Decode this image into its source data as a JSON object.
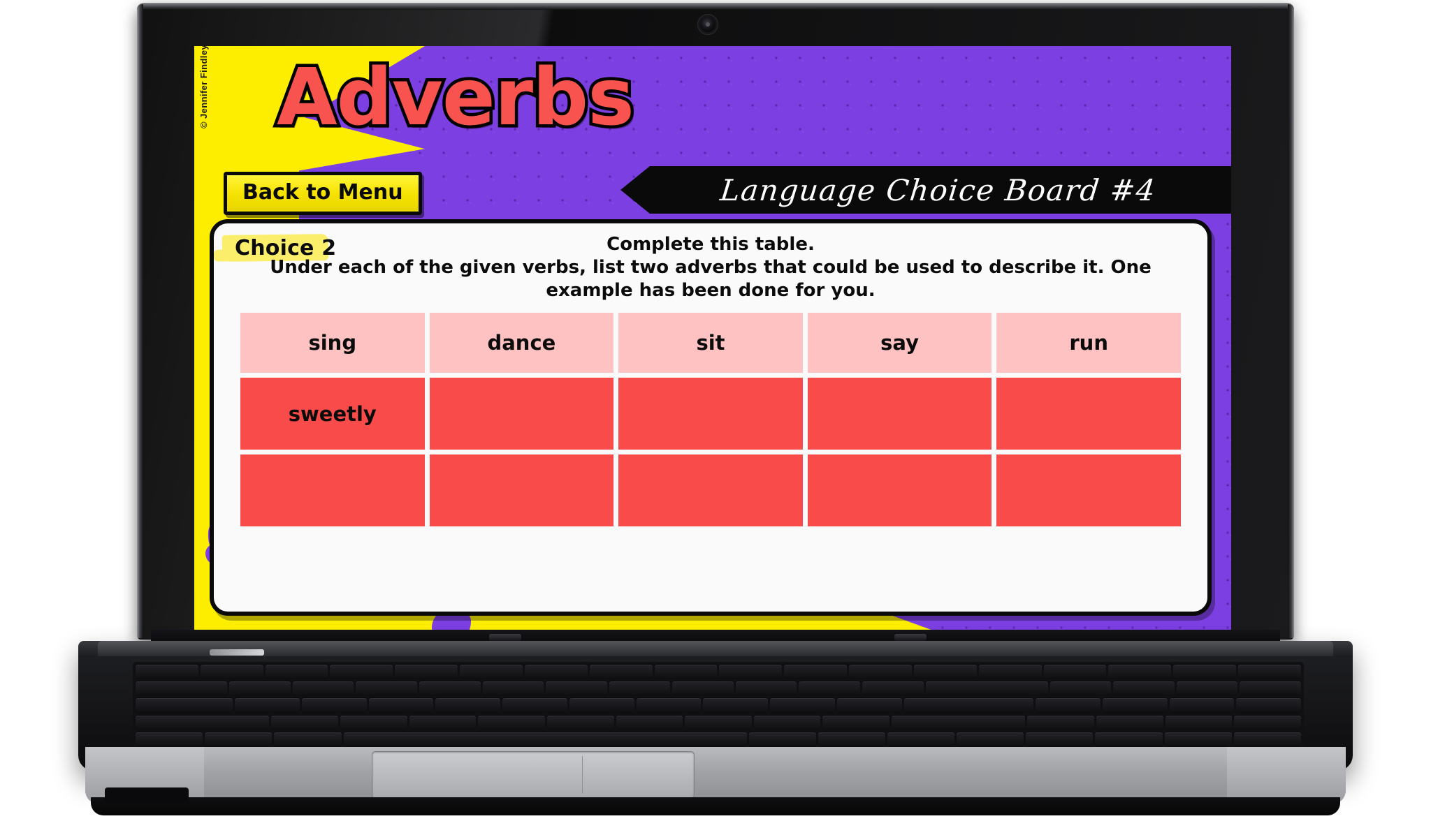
{
  "slide": {
    "title": "Adverbs",
    "copyright": "© Jennifer Findley",
    "back_button_label": "Back to Menu",
    "banner_text": "Language Choice Board #4",
    "colors": {
      "purple_background": "#7b3fe2",
      "yellow_accent": "#fdee00",
      "title_red": "#f8534e",
      "banner_black": "#0a0a0a",
      "card_white": "#fafafa",
      "header_cell_pink": "#ffc2c2",
      "body_cell_red": "#fa4b4b",
      "highlighter_yellow": "#fbee6a"
    }
  },
  "card": {
    "choice_label": "Choice 2",
    "instruction_line1": "Complete this table.",
    "instruction_line2": "Under each of the given verbs, list two adverbs that could be used to describe it. One example has been done for you."
  },
  "table": {
    "headers": [
      "sing",
      "dance",
      "sit",
      "say",
      "run"
    ],
    "rows": [
      [
        "sweetly",
        "",
        "",
        "",
        ""
      ],
      [
        "",
        "",
        "",
        "",
        ""
      ]
    ]
  },
  "device": {
    "type": "laptop",
    "webcam": "webcam-icon"
  }
}
